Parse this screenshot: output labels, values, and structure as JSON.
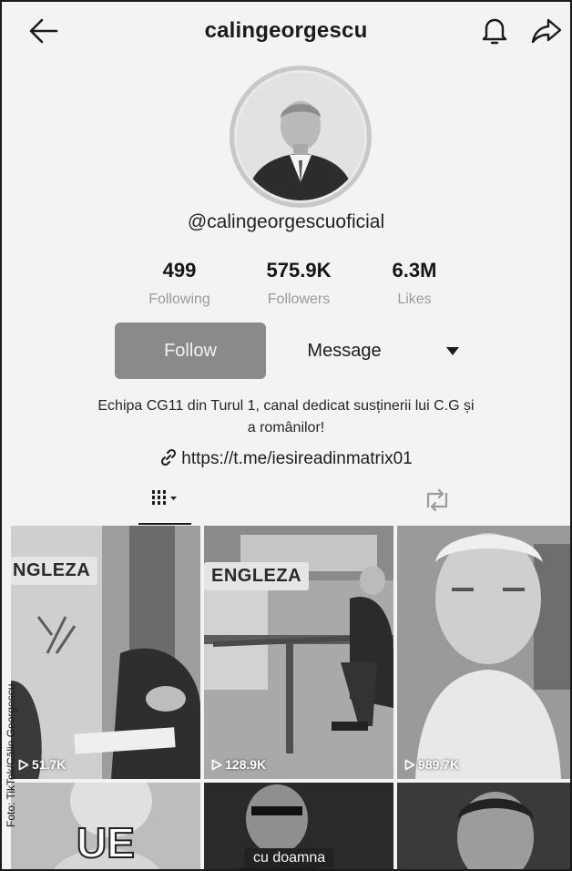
{
  "header": {
    "title": "calingeorgescu"
  },
  "profile": {
    "handle": "@calingeorgescuoficial",
    "stats": [
      {
        "value": "499",
        "label": "Following"
      },
      {
        "value": "575.9K",
        "label": "Followers"
      },
      {
        "value": "6.3M",
        "label": "Likes"
      }
    ],
    "follow_label": "Follow",
    "message_label": "Message",
    "bio_line1": "Echipa CG11 din Turul 1, canal dedicat susținerii lui C.G și",
    "bio_line2": "a românilor!",
    "link": "https://t.me/iesireadinmatrix01"
  },
  "videos": [
    {
      "views": "51.7K",
      "tag": "NGLEZA"
    },
    {
      "views": "128.9K",
      "tag": "ENGLEZA"
    },
    {
      "views": "989.7K"
    },
    {
      "overlay": "UE"
    },
    {
      "caption": "cu doamna"
    },
    {}
  ],
  "credit": "Foto: TikTok/Călin Georgescu",
  "icons": {
    "back": "arrow-left-icon",
    "bell": "bell-icon",
    "share": "share-icon",
    "link": "link-icon",
    "grid_tab": "grid-icon",
    "repost_tab": "repost-icon",
    "play": "play-icon",
    "dropdown": "caret-down-icon"
  },
  "colors": {
    "follow_button": "#8a8a8a",
    "background": "#f3f3f3"
  }
}
